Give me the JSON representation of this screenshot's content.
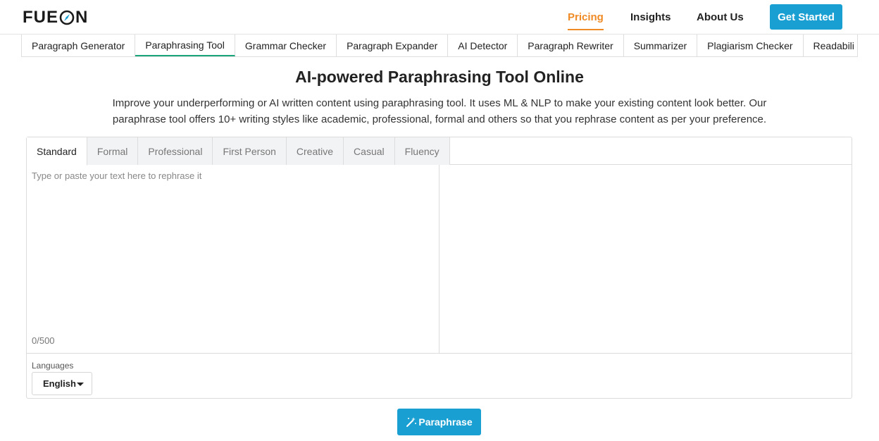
{
  "header": {
    "logo_left": "FUE",
    "logo_right": "N",
    "nav": {
      "pricing": "Pricing",
      "insights": "Insights",
      "about": "About Us"
    },
    "cta_label": "Get Started",
    "accent_color": "#f08a24",
    "brand_color": "#1a9fd2"
  },
  "tool_tabs": [
    {
      "label": "Paragraph Generator",
      "active": false
    },
    {
      "label": "Paraphrasing Tool",
      "active": true
    },
    {
      "label": "Grammar Checker",
      "active": false
    },
    {
      "label": "Paragraph Expander",
      "active": false
    },
    {
      "label": "AI Detector",
      "active": false
    },
    {
      "label": "Paragraph Rewriter",
      "active": false
    },
    {
      "label": "Summarizer",
      "active": false
    },
    {
      "label": "Plagiarism Checker",
      "active": false
    },
    {
      "label": "Readabili",
      "active": false
    }
  ],
  "page": {
    "title": "AI-powered Paraphrasing Tool Online",
    "description": "Improve your underperforming or AI written content using paraphrasing tool. It uses ML & NLP to make your existing content look better. Our paraphrase tool offers 10+ writing styles like academic, professional, formal and others so that you rephrase content as per your preference."
  },
  "editor": {
    "modes": [
      {
        "label": "Standard",
        "active": true
      },
      {
        "label": "Formal",
        "active": false
      },
      {
        "label": "Professional",
        "active": false
      },
      {
        "label": "First Person",
        "active": false
      },
      {
        "label": "Creative",
        "active": false
      },
      {
        "label": "Casual",
        "active": false
      },
      {
        "label": "Fluency",
        "active": false
      }
    ],
    "input_placeholder": "Type or paste your text here to rephrase it",
    "input_value": "",
    "counter": "0/500",
    "languages_label": "Languages",
    "language_selected": "English"
  },
  "action": {
    "paraphrase_label": "Paraphrase",
    "icon": "magic-wand-icon"
  }
}
